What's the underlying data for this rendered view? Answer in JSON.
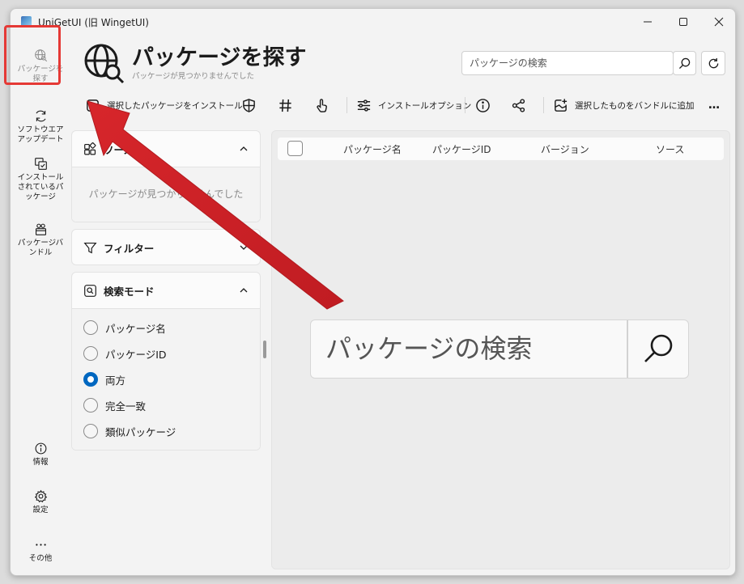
{
  "window": {
    "title": "UniGetUI (旧 WingetUI)"
  },
  "nav": {
    "items": [
      {
        "label": "パッケージを探す",
        "icon": "globe-search-icon",
        "active": true
      },
      {
        "label": "ソフトウエアアップデート",
        "icon": "sync-icon"
      },
      {
        "label": "インストールされているパッケージ",
        "icon": "installed-icon"
      },
      {
        "label": "パッケージバンドル",
        "icon": "bundle-icon"
      }
    ],
    "bottom": [
      {
        "label": "情報",
        "icon": "info-icon"
      },
      {
        "label": "設定",
        "icon": "gear-icon"
      },
      {
        "label": "その他",
        "icon": "more-icon"
      }
    ]
  },
  "header": {
    "title": "パッケージを探す",
    "subtitle": "パッケージが見つかりませんでした",
    "search_placeholder": "パッケージの検索"
  },
  "toolbar": {
    "install_label": "選択したパッケージをインストール",
    "options_label": "インストールオプション",
    "bundle_label": "選択したものをバンドルに追加",
    "more": "…"
  },
  "sources_panel": {
    "title": "ソース",
    "empty": "パッケージが見つかりませんでした"
  },
  "filter_panel": {
    "title": "フィルター"
  },
  "search_mode_panel": {
    "title": "検索モード",
    "options": [
      {
        "label": "パッケージ名",
        "selected": false
      },
      {
        "label": "パッケージID",
        "selected": false
      },
      {
        "label": "両方",
        "selected": true
      },
      {
        "label": "完全一致",
        "selected": false
      },
      {
        "label": "類似パッケージ",
        "selected": false
      }
    ]
  },
  "list": {
    "columns": [
      "パッケージ名",
      "パッケージID",
      "バージョン",
      "ソース"
    ]
  },
  "center_search": {
    "placeholder": "パッケージの検索"
  },
  "colors": {
    "accent": "#0067c0",
    "annotation": "#e53935"
  }
}
